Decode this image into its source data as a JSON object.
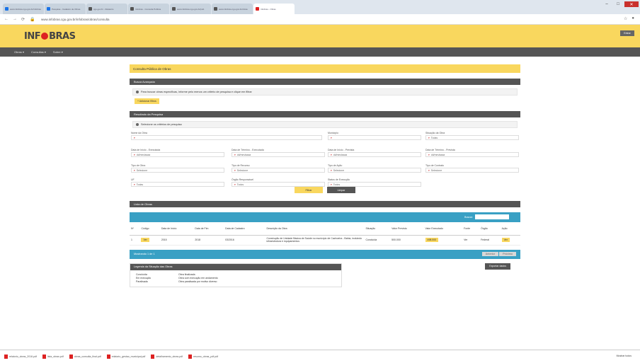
{
  "browser": {
    "tabs": [
      {
        "label": "www.infobras.cgu.gov.br/infobras",
        "fav": "#1a73e8",
        "active": false
      },
      {
        "label": "Pesquisa - Cadastro de Obras",
        "fav": "#1a73e8",
        "active": false
      },
      {
        "label": "cgu.gov.br - Relatorio",
        "fav": "#555",
        "active": false
      },
      {
        "label": "Infobras - Consulta Publica",
        "fav": "#555",
        "active": false
      },
      {
        "label": "www.infobras.cgu.gov.br/pub",
        "fav": "#555",
        "active": false
      },
      {
        "label": "www.infobras.cgu.gov.br/obras",
        "fav": "#555",
        "active": false
      },
      {
        "label": "Infobras - Obras",
        "fav": "#d22",
        "active": true
      }
    ],
    "url": "www.infobras.cgu.gov.br/infobras/obras/consulta"
  },
  "header": {
    "logo_left": "INF",
    "logo_right": "BRAS",
    "right_button": "Entrar"
  },
  "menu": [
    "Obras ▾",
    "Consultas ▾",
    "Sobre ▾"
  ],
  "page": {
    "title": "Consulta Pública de Obras",
    "section1": "Busca Avançada",
    "info_text": "Para buscar obras específicas, informe pelo menos um critério de pesquisa e clique em filtrar",
    "add_filter": "+ Adicionar filtros",
    "section2": "Resultado da Pesquisa",
    "filter_hint": "Selecione os critérios de pesquisa",
    "fields": [
      {
        "label": "Nome da Obra",
        "value": ""
      },
      {
        "label": "Município",
        "value": ""
      },
      {
        "label": "Situação da Obra",
        "value": "Todas"
      },
      {
        "label": "Data de Início - Executada",
        "value": "dd/mm/aaaa"
      },
      {
        "label": "Data de Término - Executada",
        "value": "dd/mm/aaaa"
      },
      {
        "label": "Data de Início - Prevista",
        "value": "dd/mm/aaaa"
      },
      {
        "label": "Data de Término - Prevista",
        "value": "dd/mm/aaaa"
      },
      {
        "label": "Tipo de Obra",
        "value": "Selecione"
      },
      {
        "label": "Tipo de Recurso",
        "value": "Selecione"
      },
      {
        "label": "Tipo de Ação",
        "value": "Selecione"
      },
      {
        "label": "Tipo de Contrato",
        "value": "Selecione"
      },
      {
        "label": "UF",
        "value": "Todas"
      },
      {
        "label": "Órgão Responsável",
        "value": "Todos"
      },
      {
        "label": "Status de Execução",
        "value": "Todos"
      }
    ],
    "btn_filter": "Filtrar",
    "btn_clear": "Limpar",
    "section3": "Lista de Obras",
    "search_label": "Buscar:",
    "table_headers": [
      "Nº",
      "Código",
      "Data de Início",
      "Data de Fim",
      "Data de Cadastro",
      "Descrição da Obra",
      "Situação",
      "Valor Previsto",
      "Valor Executado",
      "Fonte",
      "Órgão",
      "Ação"
    ],
    "table_row": [
      "1",
      "Ver",
      "2015",
      "2018",
      "03/2016",
      "Construção de Unidade Básica de Saúde no município de Cachoeira - Bahia, incluindo infraestrutura e equipamentos",
      "Concluída",
      "500.000",
      "498.000",
      "Ver",
      "Federal",
      "Ver"
    ],
    "table_footer": "Mostrando 1 de 1",
    "pagination": [
      "Anterior",
      "Próximo"
    ],
    "legend_title": "Legenda da Situação das Obras",
    "legend": [
      {
        "k": "Concluída",
        "v": "Obra finalizada"
      },
      {
        "k": "Em execução",
        "v": "Obra com execução em andamento"
      },
      {
        "k": "Paralisada",
        "v": "Obra paralisada por motivo diverso"
      }
    ],
    "export_btn": "Exportar dados"
  },
  "downloads": {
    "items": [
      "relatorio_obras_2016.pdf",
      "lista_obras.pdf",
      "obras_consulta_final.pdf",
      "relatorio_gestao_municipal.pdf",
      "detalhamento_obras.pdf",
      "resumo_obras_pdf.pdf"
    ],
    "show_all": "Mostrar todos"
  }
}
